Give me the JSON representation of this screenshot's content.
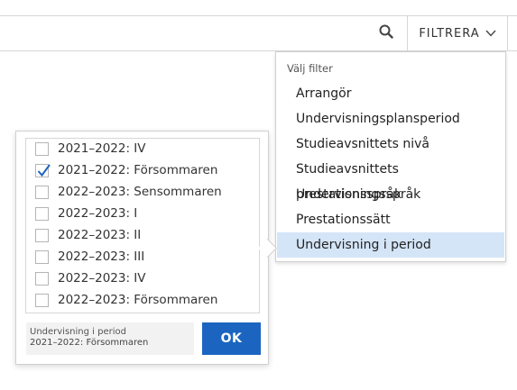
{
  "header": {
    "search_icon": "search-icon",
    "filter_label": "FILTRERA",
    "filter_icon": "chevron-down-icon"
  },
  "filter_menu": {
    "heading": "Välj filter",
    "items": [
      {
        "label": "Arrangör",
        "active": false
      },
      {
        "label": "Undervisningsplansperiod",
        "active": false
      },
      {
        "label": "Studieavsnittets nivå",
        "active": false
      },
      {
        "label": "Studieavsnittets prestationsspråk",
        "active": false
      },
      {
        "label": "Undervisningsspråk",
        "active": false
      },
      {
        "label": "Prestationssätt",
        "active": false
      },
      {
        "label": "Undervisning i period",
        "active": true
      }
    ],
    "active_color": "#d4e5f7"
  },
  "period_panel": {
    "options": [
      {
        "label": "2021–2022: IV",
        "checked": false
      },
      {
        "label": "2021–2022: Försommaren",
        "checked": true
      },
      {
        "label": "2022–2023: Sensommaren",
        "checked": false
      },
      {
        "label": "2022–2023: I",
        "checked": false
      },
      {
        "label": "2022–2023: II",
        "checked": false
      },
      {
        "label": "2022–2023: III",
        "checked": false
      },
      {
        "label": "2022–2023: IV",
        "checked": false
      },
      {
        "label": "2022–2023: Försommaren",
        "checked": false
      }
    ],
    "summary_title": "Undervisning i period",
    "summary_value": "2021–2022: Försommaren",
    "ok_label": "OK",
    "ok_color": "#1b65c0"
  }
}
